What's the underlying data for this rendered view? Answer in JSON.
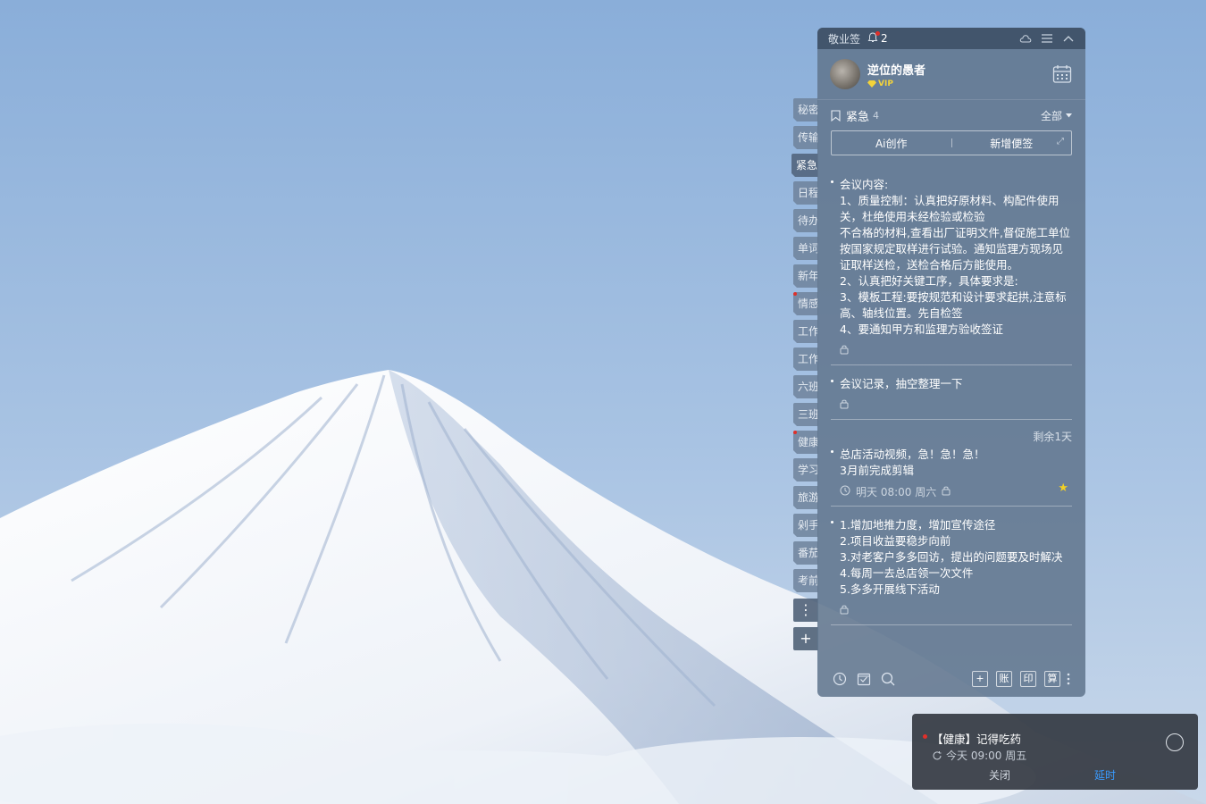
{
  "app": {
    "title": "敬业签",
    "notification_count": "2"
  },
  "profile": {
    "username": "逆位的愚者",
    "badge": "VIP"
  },
  "category": {
    "name": "紧急",
    "count": "4",
    "filter": "全部"
  },
  "actions": {
    "ai_create": "Ai创作",
    "new_note": "新增便签"
  },
  "tabs": [
    {
      "label": "秘密",
      "dot": false
    },
    {
      "label": "传输",
      "dot": false
    },
    {
      "label": "紧急",
      "dot": false,
      "active": true
    },
    {
      "label": "日程",
      "dot": false
    },
    {
      "label": "待办",
      "dot": false
    },
    {
      "label": "单词",
      "dot": false
    },
    {
      "label": "新年",
      "dot": false
    },
    {
      "label": "情感",
      "dot": true
    },
    {
      "label": "工作",
      "dot": false
    },
    {
      "label": "工作",
      "dot": false
    },
    {
      "label": "六班",
      "dot": false
    },
    {
      "label": "三班",
      "dot": false
    },
    {
      "label": "健康",
      "dot": true
    },
    {
      "label": "学习",
      "dot": false
    },
    {
      "label": "旅游",
      "dot": false
    },
    {
      "label": "剁手",
      "dot": false
    },
    {
      "label": "番茄",
      "dot": false
    },
    {
      "label": "考前",
      "dot": false
    }
  ],
  "notes": [
    {
      "text": "会议内容:\n1、质量控制：认真把好原材料、构配件使用关，杜绝使用未经检验或检验\n不合格的材料,查看出厂证明文件,督促施工单位按国家规定取样进行试验。通知监理方现场见证取样送检，送检合格后方能使用。\n2、认真把好关键工序，具体要求是:\n3、模板工程:要按规范和设计要求起拱,注意标高、轴线位置。先自检签\n4、要通知甲方和监理方验收签证"
    },
    {
      "text": "会议记录，抽空整理一下"
    },
    {
      "deadline": "剩余1天",
      "text": "总店活动视频，急！急！急！\n3月前完成剪辑",
      "reminder": "明天 08:00 周六",
      "starred": true
    },
    {
      "text": "1.增加地推力度，增加宣传途径\n2.项目收益要稳步向前\n3.对老客户多多回访，提出的问题要及时解决\n4.每周一去总店领一次文件\n5.多多开展线下活动"
    }
  ],
  "bottom_tools": [
    "账",
    "印",
    "算"
  ],
  "toast": {
    "title": "【健康】记得吃药",
    "time": "今天 09:00 周五",
    "close": "关闭",
    "snooze": "延时"
  },
  "colors": {
    "accent_blue": "#3a9bff",
    "alert_red": "#e0302a",
    "star_yellow": "#f2d024"
  }
}
